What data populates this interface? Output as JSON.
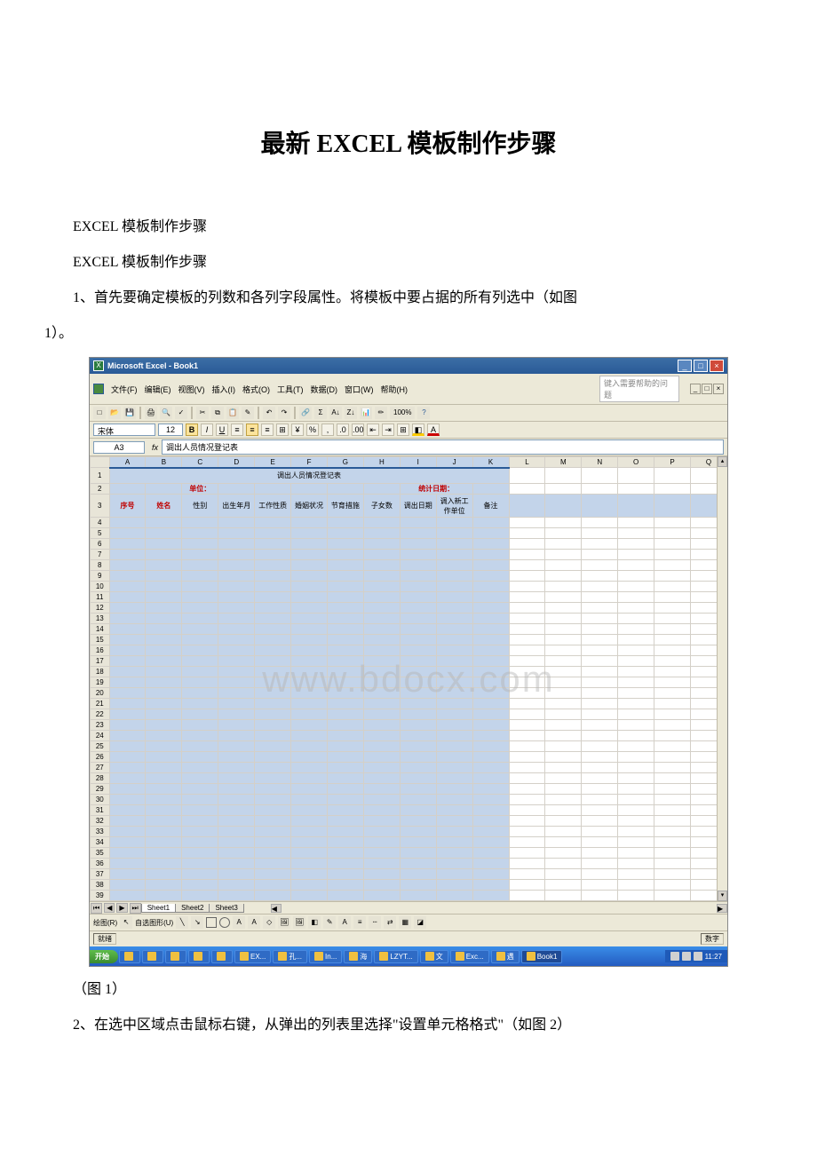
{
  "doc": {
    "title": "最新 EXCEL 模板制作步骤",
    "p1": "EXCEL 模板制作步骤",
    "p2": "EXCEL 模板制作步骤",
    "p3_a": "1、首先要确定模板的列数和各列字段属性。将模板中要占据的所有列选中（如图",
    "p3_b": "1）。",
    "caption1": "（图 1）",
    "p4": "2、在选中区域点击鼠标右键，从弹出的列表里选择\"设置单元格格式\"（如图 2）"
  },
  "excel": {
    "app_title": "Microsoft Excel - Book1",
    "menu": {
      "file": "文件(F)",
      "edit": "编辑(E)",
      "view": "视图(V)",
      "insert": "插入(I)",
      "format": "格式(O)",
      "tools": "工具(T)",
      "data": "数据(D)",
      "window": "窗口(W)",
      "help": "帮助(H)",
      "help_box": "键入需要帮助的问题"
    },
    "font": {
      "name": "宋体",
      "size": "12"
    },
    "namebox": "A3",
    "formula": "调出人员情况登记表",
    "zoom": "100%",
    "columns": [
      "A",
      "B",
      "C",
      "D",
      "E",
      "F",
      "G",
      "H",
      "I",
      "J",
      "K",
      "L",
      "M",
      "N",
      "O",
      "P",
      "Q"
    ],
    "sel_cols": [
      "A",
      "B",
      "C",
      "D",
      "E",
      "F",
      "G",
      "H",
      "I",
      "J",
      "K"
    ],
    "sheet_title": "调出人员情况登记表",
    "row2": {
      "unit_label": "单位：",
      "date_label": "统计日期："
    },
    "headers": [
      "序号",
      "姓名",
      "性别",
      "出生年月",
      "工作性质",
      "婚姻状况",
      "节育措施",
      "子女数",
      "调出日期",
      "调入新工作单位",
      "备注"
    ],
    "row_numbers": [
      "1",
      "2",
      "3",
      "4",
      "5",
      "6",
      "7",
      "8",
      "9",
      "10",
      "11",
      "12",
      "13",
      "14",
      "15",
      "16",
      "17",
      "18",
      "19",
      "20",
      "21",
      "22",
      "23",
      "24",
      "25",
      "26",
      "27",
      "28",
      "29",
      "30",
      "31",
      "32",
      "33",
      "34",
      "35",
      "36",
      "37",
      "38",
      "39"
    ],
    "sheets": [
      "Sheet1",
      "Sheet2",
      "Sheet3"
    ],
    "draw_label": "绘图(R)",
    "autoshape": "自选图形(U)",
    "status": "就绪",
    "status_right": "数字",
    "watermark": "www.bdocx.com"
  },
  "taskbar": {
    "start": "开始",
    "items": [
      {
        "label": ""
      },
      {
        "label": ""
      },
      {
        "label": ""
      },
      {
        "label": ""
      },
      {
        "label": ""
      },
      {
        "label": "EX..."
      },
      {
        "label": "孔..."
      },
      {
        "label": "In..."
      },
      {
        "label": "海"
      },
      {
        "label": "LZYT..."
      },
      {
        "label": "文"
      },
      {
        "label": "Exc..."
      },
      {
        "label": "遇"
      },
      {
        "label": "Book1"
      }
    ],
    "time": "11:27"
  }
}
